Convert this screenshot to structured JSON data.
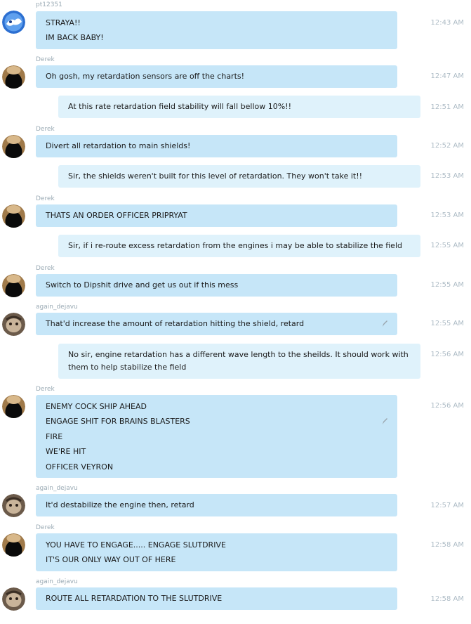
{
  "chat": {
    "messages": [
      {
        "sender": "pt12351",
        "time": "12:43 AM",
        "lines": [
          "STRAYA!!",
          "IM BACK BABY!"
        ]
      },
      {
        "sender": "Derek",
        "time": "12:47 AM",
        "lines": [
          "Oh gosh, my retardation sensors are off the charts!"
        ]
      },
      {
        "time": "12:51 AM",
        "lines": [
          "At this rate retardation field stability will fall bellow 10%!!"
        ]
      },
      {
        "sender": "Derek",
        "time": "12:52 AM",
        "lines": [
          "Divert all retardation to main shields!"
        ]
      },
      {
        "time": "12:53 AM",
        "lines": [
          "Sir, the shields weren't built for this level of retardation. They won't take it!!"
        ]
      },
      {
        "sender": "Derek",
        "time": "12:53 AM",
        "lines": [
          "THATS AN ORDER OFFICER PRIPRYAT"
        ]
      },
      {
        "time": "12:55 AM",
        "lines": [
          "Sir, if i re-route excess retardation from the engines i may be able to stabilize the field"
        ]
      },
      {
        "sender": "Derek",
        "time": "12:55 AM",
        "lines": [
          "Switch to Dipshit drive and get us out if this mess"
        ]
      },
      {
        "sender": "again_dejavu",
        "time": "12:55 AM",
        "lines": [
          "That'd increase the amount of retardation hitting the shield, retard"
        ]
      },
      {
        "time": "12:56 AM",
        "lines": [
          "No sir, engine retardation has a different wave length to the sheilds. It should work with",
          "them to help stabilize the field"
        ]
      },
      {
        "sender": "Derek",
        "time": "12:56 AM",
        "lines": [
          "ENEMY COCK SHIP AHEAD",
          "ENGAGE SHIT FOR BRAINS BLASTERS",
          "FIRE",
          "WE'RE HIT",
          "OFFICER VEYRON"
        ]
      },
      {
        "sender": "again_dejavu",
        "time": "12:57 AM",
        "lines": [
          "It'd destabilize the engine then, retard"
        ]
      },
      {
        "sender": "Derek",
        "time": "12:58 AM",
        "lines": [
          "YOU HAVE TO ENGAGE..... ENGAGE SLUTDRIVE",
          "IT'S OUR ONLY WAY OUT OF HERE"
        ]
      },
      {
        "sender": "again_dejavu",
        "time": "12:58 AM",
        "lines": [
          "ROUTE ALL RETARDATION TO THE SLUTDRIVE"
        ]
      }
    ]
  }
}
